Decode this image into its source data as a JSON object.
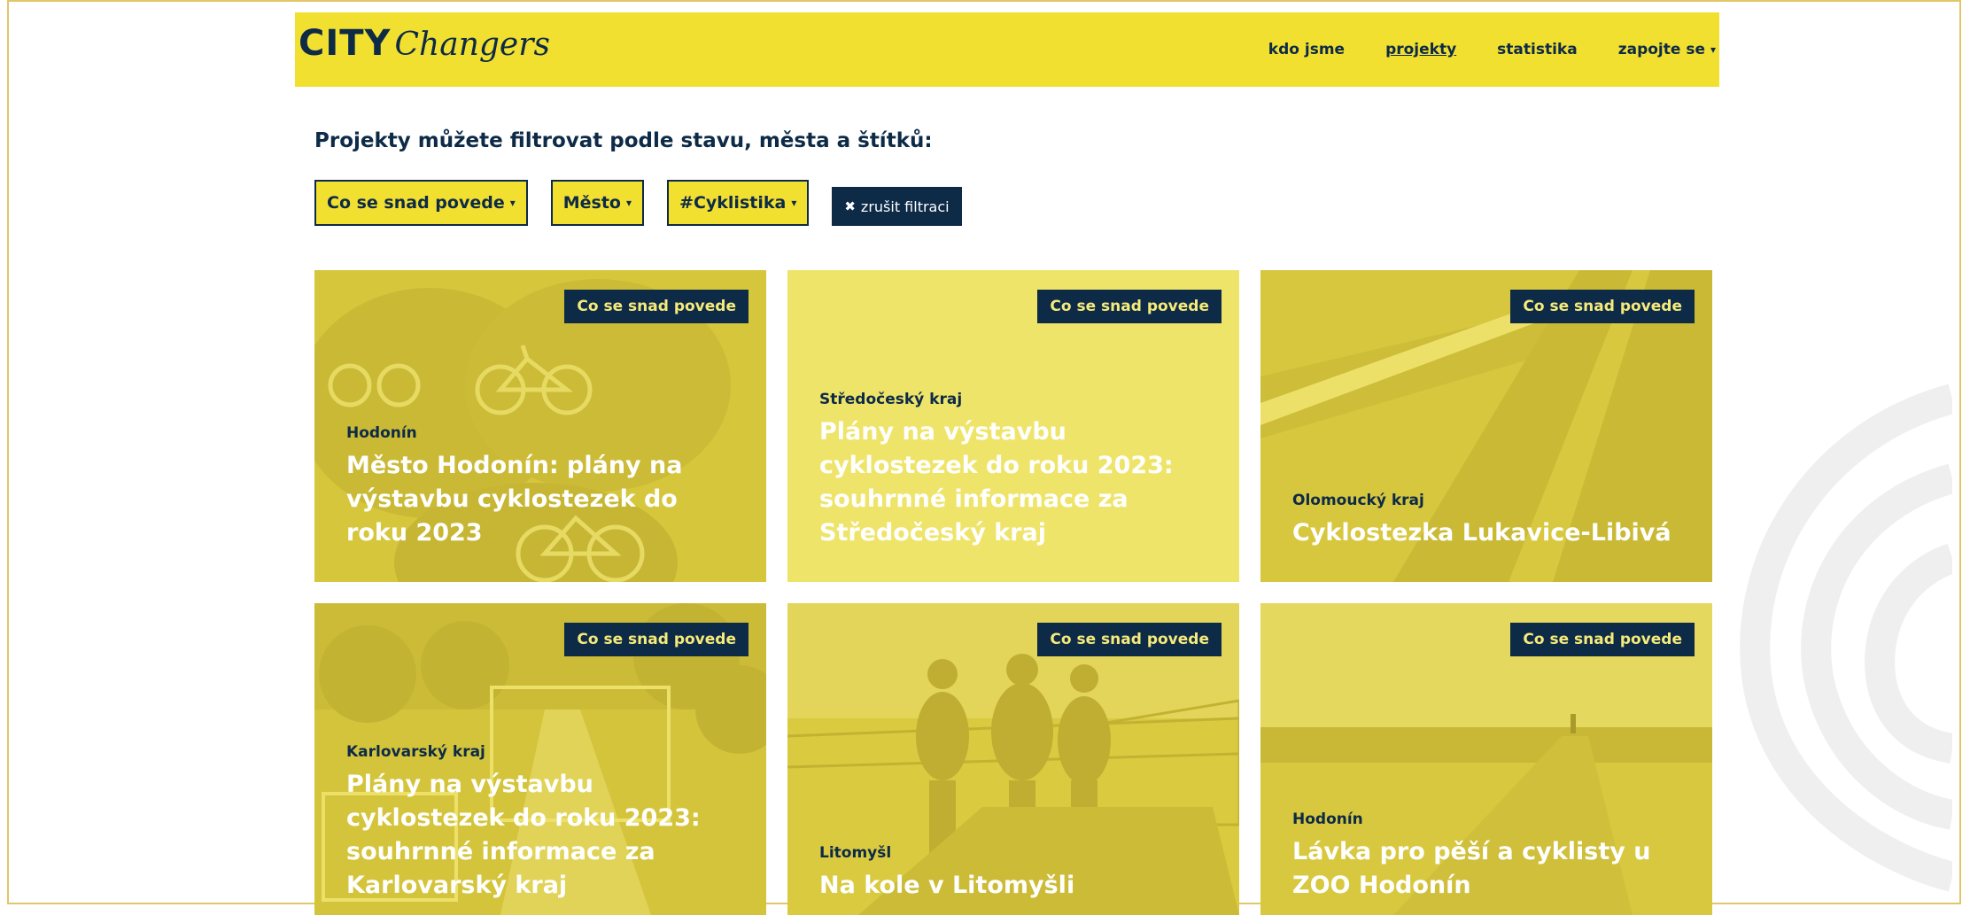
{
  "logo": {
    "city": "CITY",
    "changers": "Changers"
  },
  "nav": [
    {
      "label": "kdo jsme",
      "active": false,
      "dropdown": false
    },
    {
      "label": "projekty",
      "active": true,
      "dropdown": false
    },
    {
      "label": "statistika",
      "active": false,
      "dropdown": false
    },
    {
      "label": "zapojte se",
      "active": false,
      "dropdown": true
    }
  ],
  "filters": {
    "heading": "Projekty můžete filtrovat podle stavu, města a štítků:",
    "status": "Co se snad povede",
    "city": "Město",
    "tag": "#Cyklistika",
    "clear": "zrušit filtraci"
  },
  "colors": {
    "brand_yellow": "#f2e030",
    "navy": "#0d2a47",
    "card_yellow": "#d9c93c",
    "card_light": "#efe46a"
  },
  "cards": [
    {
      "status": "Co se snad povede",
      "city": "Hodonín",
      "title": "Město Hodonín: plány na výstavbu cyklostezek do roku 2023",
      "image": "bike-sign-photo"
    },
    {
      "status": "Co se snad povede",
      "city": "Středočeský kraj",
      "title": "Plány na výstavbu cyklostezek do roku 2023: souhrnné informace za Středočeský kraj",
      "image": "none"
    },
    {
      "status": "Co se snad povede",
      "city": "Olomoucký kraj",
      "title": "Cyklostezka Lukavice-Libivá",
      "image": "road-photo"
    },
    {
      "status": "Co se snad povede",
      "city": "Karlovarský kraj",
      "title": "Plány na výstavbu cyklostezek do roku 2023: souhrnné informace za Karlovarský kraj",
      "image": "path-photo"
    },
    {
      "status": "Co se snad povede",
      "city": "Litomyšl",
      "title": "Na kole v Litomyšli",
      "image": "cyclists-photo"
    },
    {
      "status": "Co se snad povede",
      "city": "Hodonín",
      "title": "Lávka pro pěší a cyklisty u ZOO Hodonín",
      "image": "bridge-photo"
    }
  ]
}
